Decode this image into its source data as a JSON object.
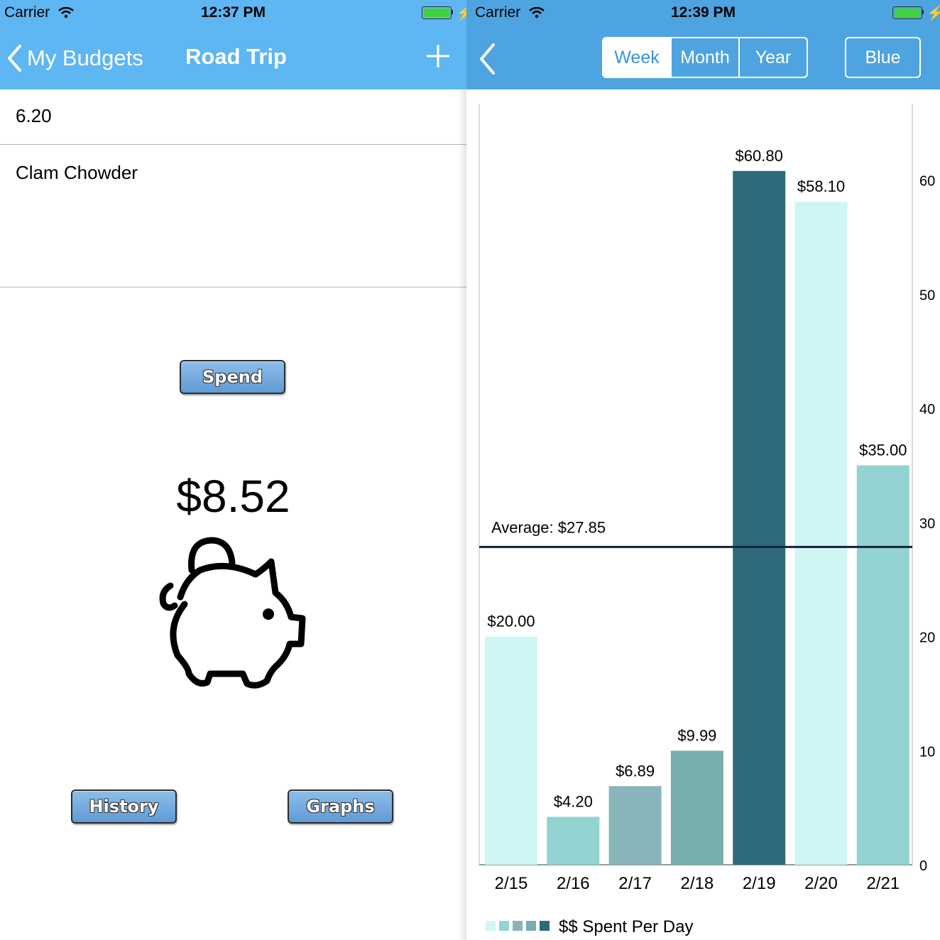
{
  "left": {
    "status": {
      "carrier": "Carrier",
      "time": "12:37 PM"
    },
    "nav": {
      "back_label": "My Budgets",
      "title": "Road Trip"
    },
    "amount_value": "6.20",
    "memo_value": "Clam Chowder",
    "spend_label": "Spend",
    "balance": "$8.52",
    "history_label": "History",
    "graphs_label": "Graphs"
  },
  "right": {
    "status": {
      "carrier": "Carrier",
      "time": "12:39 PM"
    },
    "segments": [
      "Week",
      "Month",
      "Year"
    ],
    "active_segment": "Week",
    "theme_label": "Blue"
  },
  "colors": {
    "left_bar": "#5eb6f2",
    "right_bar": "#4ea4e0",
    "average_line": "#14213d"
  },
  "chart_data": {
    "type": "bar",
    "categories": [
      "2/15",
      "2/16",
      "2/17",
      "2/18",
      "2/19",
      "2/20",
      "2/21"
    ],
    "values": [
      20.0,
      4.2,
      6.89,
      9.99,
      60.8,
      58.1,
      35.0
    ],
    "value_labels": [
      "$20.00",
      "$4.20",
      "$6.89",
      "$9.99",
      "$60.80",
      "$58.10",
      "$35.00"
    ],
    "bar_colors": [
      "#cff6f4",
      "#93d3d1",
      "#88b5ba",
      "#78aeac",
      "#2e6a7b",
      "#cff6f4",
      "#93d3d1"
    ],
    "ylim": [
      0,
      66.7
    ],
    "yticks": [
      0,
      10,
      20,
      30,
      40,
      50,
      60
    ],
    "y_axis_side": "right",
    "average": {
      "value": 27.85,
      "label": "Average: $27.85"
    },
    "legend": {
      "label": "$$ Spent Per Day",
      "swatches": [
        "#cff6f4",
        "#93d3d1",
        "#88b5ba",
        "#78aeac",
        "#2e6a7b"
      ]
    },
    "grid": false
  }
}
